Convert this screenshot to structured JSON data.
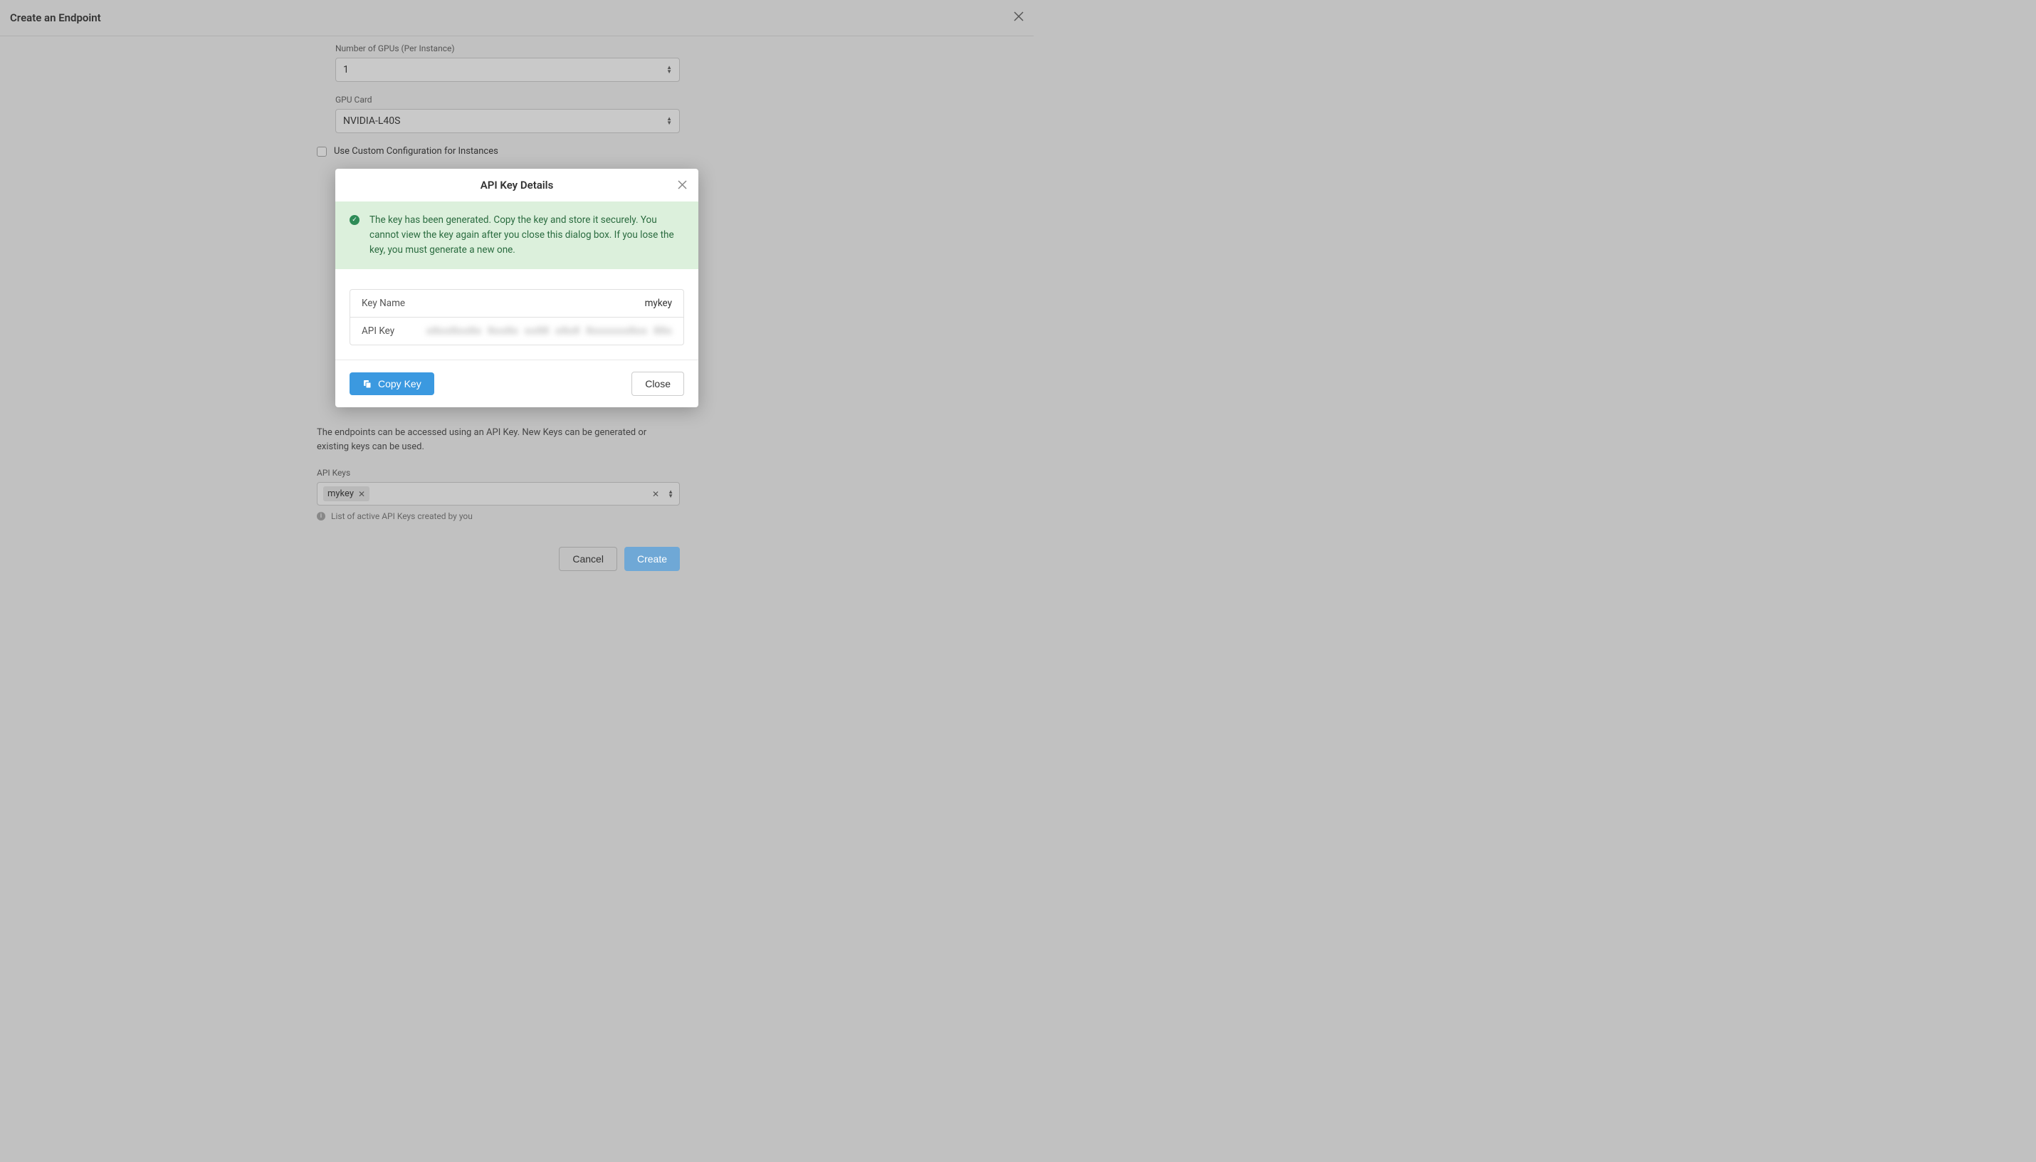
{
  "header": {
    "title": "Create an Endpoint"
  },
  "form": {
    "gpu_count_label": "Number of GPUs (Per Instance)",
    "gpu_count_value": "1",
    "gpu_card_label": "GPU Card",
    "gpu_card_value": "NVIDIA-L40S",
    "custom_config_label": "Use Custom Configuration for Instances",
    "api_keys_desc": "The endpoints can be accessed using an API Key. New Keys can be generated or existing keys can be used.",
    "api_keys_label": "API Keys",
    "api_keys_selected": "mykey",
    "api_keys_helper": "List of active API Keys created by you",
    "cancel_label": "Cancel",
    "create_label": "Create"
  },
  "modal": {
    "title": "API Key Details",
    "alert_text": "The key has been generated. Copy the key and store it securely. You cannot view the key again after you close this dialog box. If you lose the key, you must generate a new one.",
    "key_name_label": "Key Name",
    "key_name_value": "mykey",
    "api_key_label": "API Key",
    "api_key_value": "xXxxXxxXx XxxXx xxXX xXxX XxxxxxxXxx XXx",
    "copy_label": "Copy Key",
    "close_label": "Close"
  }
}
